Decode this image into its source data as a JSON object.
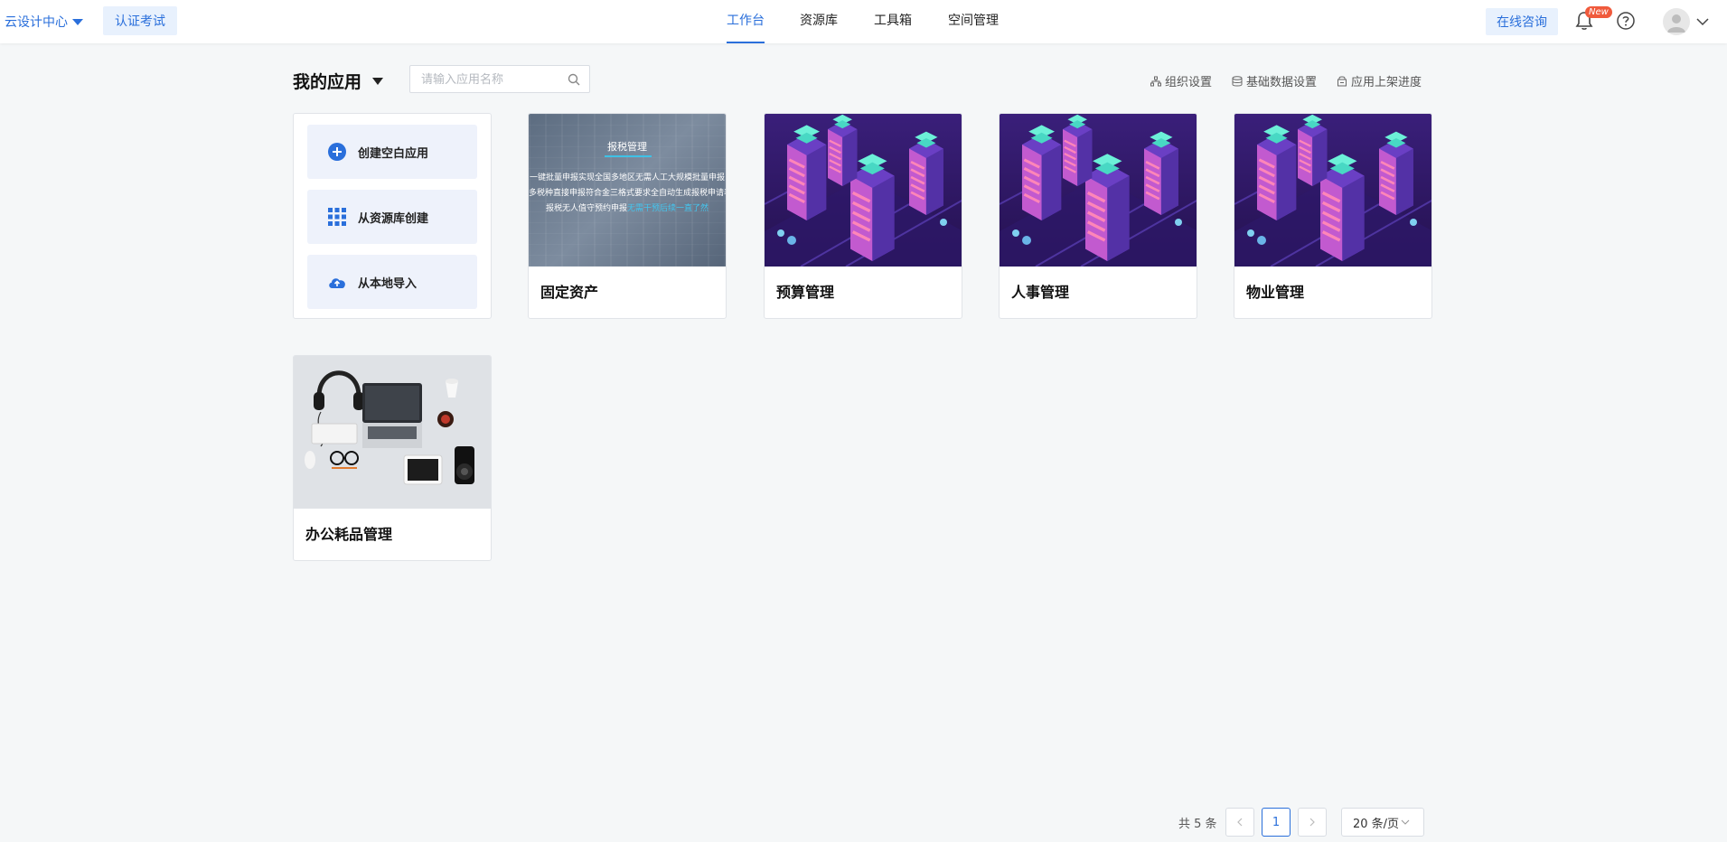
{
  "topbar": {
    "brand": "云设计中心",
    "cert_button": "认证考试",
    "nav": [
      {
        "label": "工作台",
        "active": true
      },
      {
        "label": "资源库",
        "active": false
      },
      {
        "label": "工具箱",
        "active": false
      },
      {
        "label": "空间管理",
        "active": false
      }
    ],
    "consult_button": "在线咨询",
    "new_badge": "New"
  },
  "header": {
    "title": "我的应用",
    "search_placeholder": "请输入应用名称",
    "links": [
      {
        "label": "组织设置",
        "icon": "org-icon"
      },
      {
        "label": "基础数据设置",
        "icon": "database-icon"
      },
      {
        "label": "应用上架进度",
        "icon": "shelf-icon"
      }
    ]
  },
  "create_panel": {
    "items": [
      {
        "label": "创建空白应用",
        "icon": "plus-circle-icon"
      },
      {
        "label": "从资源库创建",
        "icon": "grid-icon"
      },
      {
        "label": "从本地导入",
        "icon": "cloud-upload-icon"
      }
    ]
  },
  "apps": [
    {
      "name": "固定资产",
      "thumb": "tax"
    },
    {
      "name": "预算管理",
      "thumb": "building"
    },
    {
      "name": "人事管理",
      "thumb": "building"
    },
    {
      "name": "物业管理",
      "thumb": "building"
    },
    {
      "name": "办公耗品管理",
      "thumb": "office"
    }
  ],
  "tax_thumb": {
    "title": "报税管理",
    "lines": [
      "一键批量申报实现全国多地区无需人工大规模批量申报",
      "多税种直接申报符合金三格式要求全自动生成报税申请表"
    ],
    "line3_prefix": "报税无人值守预约申报",
    "line3_highlight": "无需干预后续一直了然"
  },
  "pagination": {
    "total": "共 5 条",
    "current_page": "1",
    "page_size": "20 条/页"
  },
  "colors": {
    "accent": "#2a6fdb",
    "badge": "#f05a3c",
    "background": "#f5f7f8"
  }
}
